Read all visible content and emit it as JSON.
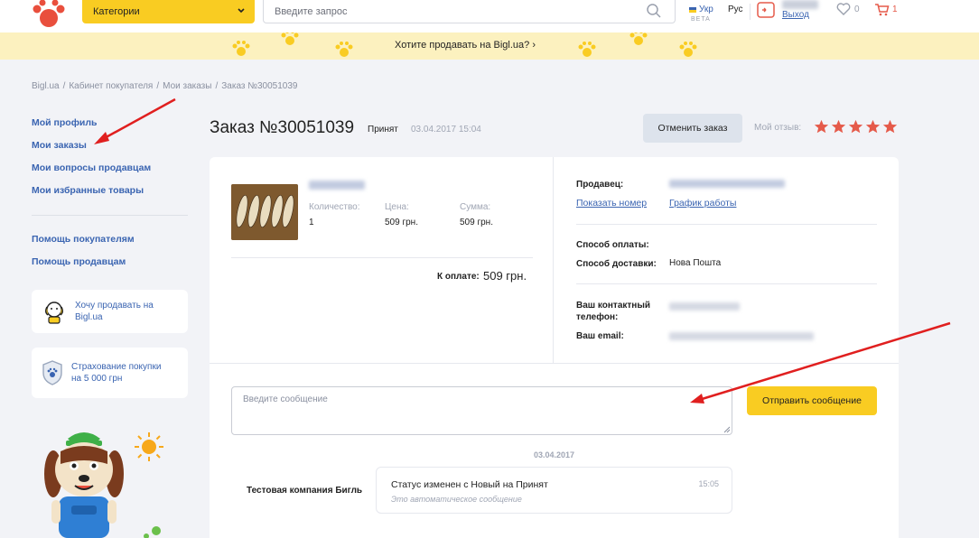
{
  "header": {
    "categories_label": "Категории",
    "search_placeholder": "Введите запрос",
    "lang_ukr": "Укр",
    "beta": "BETA",
    "lang_rus": "Рус",
    "logout": "Выход",
    "favorites_count": "0",
    "cart_count": "1"
  },
  "promo": {
    "text": "Хотите продавать на Bigl.ua? ›"
  },
  "breadcrumb": {
    "items": [
      "Bigl.ua",
      "Кабинет покупателя",
      "Мои заказы",
      "Заказ №30051039"
    ],
    "separator": "/"
  },
  "sidebar": {
    "links": [
      "Мой профиль",
      "Мои заказы",
      "Мои вопросы продавцам",
      "Мои избранные товары"
    ],
    "help_links": [
      "Помощь покупателям",
      "Помощь продавцам"
    ],
    "card_sell": "Хочу продавать на Bigl.ua",
    "card_insurance": "Страхование покупки на 5 000 грн"
  },
  "order": {
    "title": "Заказ №30051039",
    "status": "Принят",
    "date": "03.04.2017 15:04",
    "cancel_label": "Отменить заказ",
    "review_label": "Мой отзыв:",
    "rating": 5,
    "quantity_label": "Количество:",
    "quantity": "1",
    "price_label": "Цена:",
    "price": "509 грн.",
    "sum_label": "Сумма:",
    "sum": "509 грн.",
    "to_pay_label": "К оплате:",
    "to_pay": "509 грн."
  },
  "seller": {
    "seller_label": "Продавец:",
    "show_number": "Показать номер",
    "work_schedule": "График работы",
    "payment_label": "Способ оплаты:",
    "delivery_label": "Способ доставки:",
    "delivery_value": "Нова Пошта",
    "phone_label": "Ваш контактный телефон:",
    "email_label": "Ваш email:"
  },
  "messages": {
    "input_placeholder": "Введите сообщение",
    "send_label": "Отправить сообщение",
    "date": "03.04.2017",
    "sender": "Тестовая компания Бигль",
    "text": "Статус изменен с Новый на Принят",
    "time": "15:05",
    "sub": "Это автоматическое сообщение"
  },
  "colors": {
    "accent": "#f9cc22",
    "link": "#3a64b1",
    "star": "#e55a4a",
    "arrow": "#e01f1f"
  }
}
